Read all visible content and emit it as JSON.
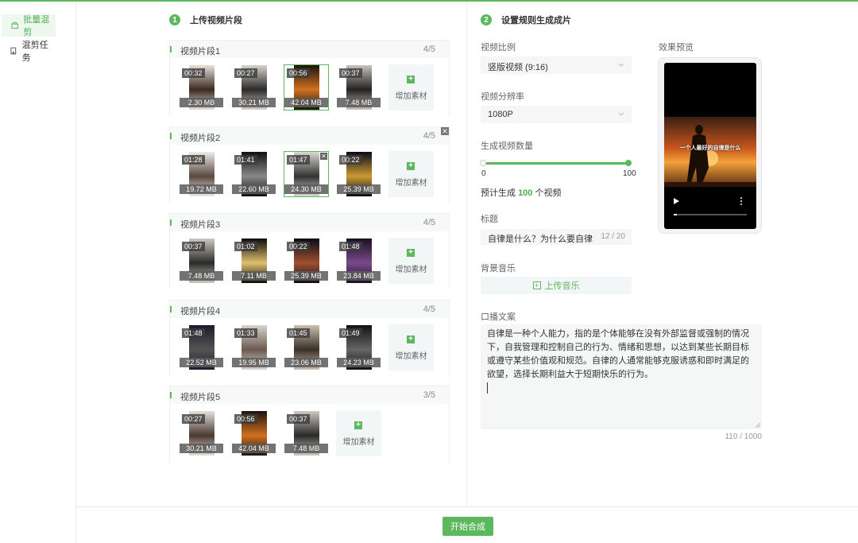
{
  "sidebar": {
    "items": [
      {
        "label": "批量混剪",
        "icon": "clip-icon",
        "active": true
      },
      {
        "label": "混剪任务",
        "icon": "building-icon",
        "active": false
      }
    ]
  },
  "left": {
    "step_num": "1",
    "step_title": "上传视频片段",
    "add_label": "增加素材",
    "segments": [
      {
        "title": "视频片段1",
        "count": "4/5",
        "clips": [
          {
            "dur": "00:32",
            "size": "2.30 MB"
          },
          {
            "dur": "00:27",
            "size": "30.21 MB"
          },
          {
            "dur": "00:56",
            "size": "42.04 MB"
          },
          {
            "dur": "00:37",
            "size": "7.48 MB"
          }
        ]
      },
      {
        "title": "视频片段2",
        "count": "4/5",
        "clips": [
          {
            "dur": "01:28",
            "size": "19.72 MB"
          },
          {
            "dur": "01:41",
            "size": "22.60 MB"
          },
          {
            "dur": "01:47",
            "size": "24.30 MB"
          },
          {
            "dur": "00:22",
            "size": "25.39 MB"
          }
        ]
      },
      {
        "title": "视频片段3",
        "count": "4/5",
        "clips": [
          {
            "dur": "00:37",
            "size": "7.48 MB"
          },
          {
            "dur": "01:02",
            "size": "7.11 MB"
          },
          {
            "dur": "00:22",
            "size": "25.39 MB"
          },
          {
            "dur": "01:48",
            "size": "23.84 MB"
          }
        ]
      },
      {
        "title": "视频片段4",
        "count": "4/5",
        "clips": [
          {
            "dur": "01:48",
            "size": "22.52 MB"
          },
          {
            "dur": "01:33",
            "size": "19.95 MB"
          },
          {
            "dur": "01:45",
            "size": "23.06 MB"
          },
          {
            "dur": "01:49",
            "size": "24.23 MB"
          }
        ]
      },
      {
        "title": "视频片段5",
        "count": "3/5",
        "clips": [
          {
            "dur": "00:27",
            "size": "30.21 MB"
          },
          {
            "dur": "00:56",
            "size": "42.04 MB"
          },
          {
            "dur": "00:37",
            "size": "7.48 MB"
          }
        ]
      }
    ]
  },
  "right": {
    "step_num": "2",
    "step_title": "设置规则生成成片",
    "ratio_label": "视频比例",
    "ratio_value": "竖版视频 (9:16)",
    "res_label": "视频分辨率",
    "res_value": "1080P",
    "count_label": "生成视频数量",
    "slider_min": "0",
    "slider_max": "100",
    "slider_value": 100,
    "estimate_prefix": "预计生成",
    "estimate_value": "100",
    "estimate_suffix": "个视频",
    "title_label": "标题",
    "title_value": "自律是什么？为什么要自律",
    "title_count": "12 / 20",
    "music_label": "背景音乐",
    "music_button": "上传音乐",
    "script_label": "口播文案",
    "script_value": "自律是一种个人能力，指的是个体能够在没有外部监督或强制的情况下，自我管理和控制自己的行为、情绪和思想，以达到某些长期目标或遵守某些价值观和规范。自律的人通常能够克服诱惑和即时满足的欲望，选择长期利益大于短期快乐的行为。",
    "script_count": "110 / 1000",
    "preview_label": "效果预览",
    "preview_caption": "一个人最好的自律是什么"
  },
  "footer": {
    "start_button": "开始合成"
  },
  "colors": {
    "accent": "#5cb85c"
  }
}
